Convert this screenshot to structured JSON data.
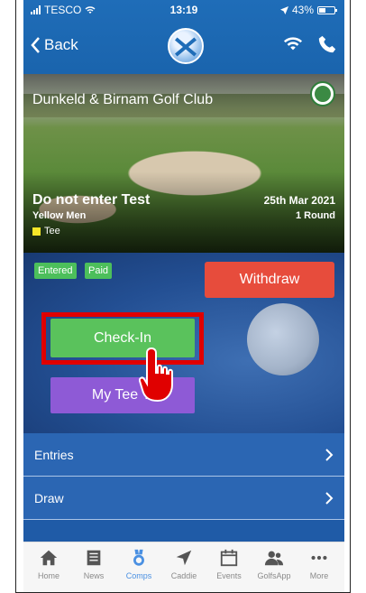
{
  "status": {
    "carrier": "TESCO",
    "time": "13:19",
    "battery": "43%"
  },
  "nav": {
    "back_label": "Back"
  },
  "hero": {
    "club_name": "Dunkeld & Birnam Golf Club",
    "competition_title": "Do not enter Test",
    "tee_group": "Yellow Men",
    "tee_label": "Tee",
    "tee_color": "#f5e628",
    "date": "25th Mar 2021",
    "rounds": "1 Round"
  },
  "action": {
    "badges": [
      "Entered",
      "Paid"
    ],
    "withdraw_label": "Withdraw",
    "checkin_label": "Check-In",
    "mytee_label": "My Tee Ti"
  },
  "list": {
    "items": [
      {
        "label": "Entries"
      },
      {
        "label": "Draw"
      }
    ]
  },
  "tabs": [
    {
      "label": "Home",
      "icon": "home-icon"
    },
    {
      "label": "News",
      "icon": "news-icon"
    },
    {
      "label": "Comps",
      "icon": "medal-icon",
      "active": true
    },
    {
      "label": "Caddie",
      "icon": "navigation-arrow-icon"
    },
    {
      "label": "Events",
      "icon": "calendar-icon"
    },
    {
      "label": "GolfsApp",
      "icon": "people-icon"
    },
    {
      "label": "More",
      "icon": "more-dots-icon"
    }
  ],
  "colors": {
    "brand": "#1f6db8",
    "withdraw": "#e74c3c",
    "checkin": "#5ac25c",
    "mytee": "#8e5ad6",
    "badge": "#4cbf5b",
    "highlight": "#e00000",
    "active_tab": "#4a90e2"
  }
}
